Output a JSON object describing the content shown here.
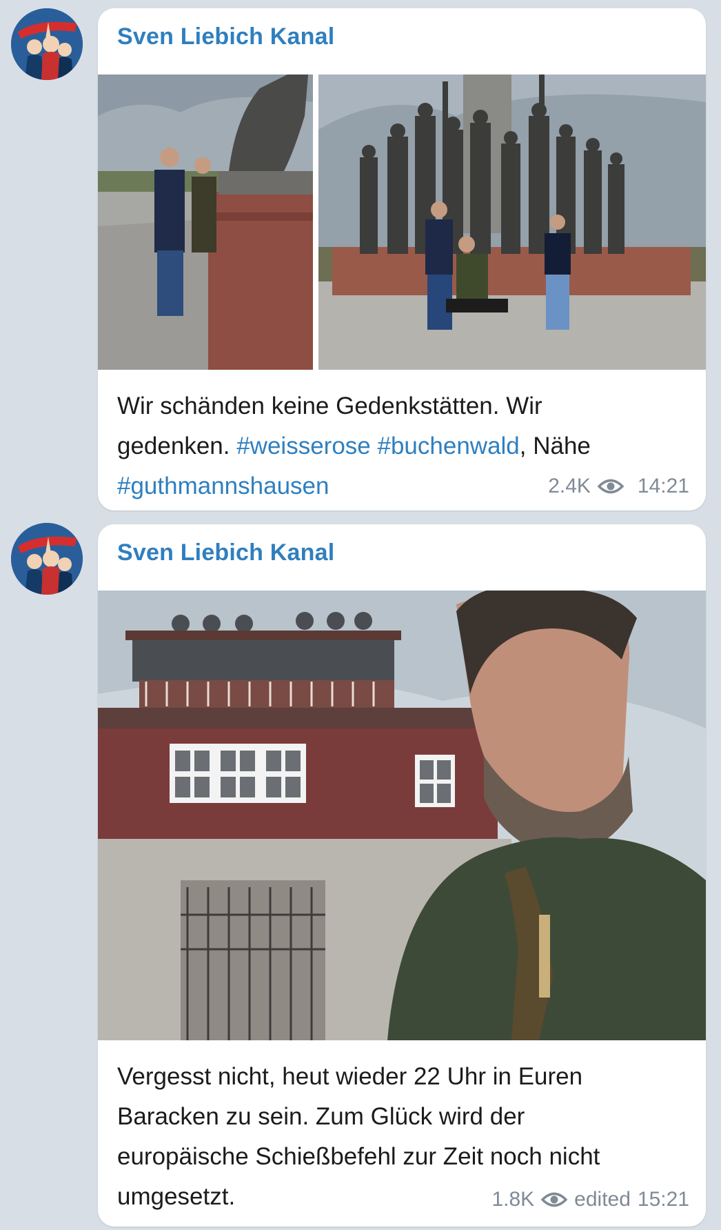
{
  "posts": [
    {
      "channel": "Sven Liebich Kanal",
      "caption": {
        "line1": "Wir schänden keine Gedenkstätten. Wir",
        "line2_text": "gedenken. ",
        "hashtag1": "#weisserose",
        "space": " ",
        "hashtag2": "#buchenwald",
        "line2_suffix": ", Nähe",
        "hashtag3": "#guthmannshausen"
      },
      "views": "2.4K",
      "edited": "",
      "time": "14:21",
      "icons": {
        "avatar": "channel-avatar-icon",
        "views": "eye-icon"
      }
    },
    {
      "channel": "Sven Liebich Kanal",
      "caption": {
        "line1": "Vergesst nicht, heut wieder 22 Uhr in Euren",
        "line2": "Baracken zu sein. Zum Glück wird der",
        "line3": "europäische Schießbefehl zur Zeit noch nicht",
        "line4": "umgesetzt."
      },
      "views": "1.8K",
      "edited": "edited",
      "time": "15:21",
      "icons": {
        "avatar": "channel-avatar-icon",
        "views": "eye-icon"
      }
    }
  ],
  "colors": {
    "background": "#d7dee6",
    "bubble": "#ffffff",
    "accent": "#2f7fbf",
    "meta": "#7f8a96",
    "text": "#1b1b1b"
  }
}
